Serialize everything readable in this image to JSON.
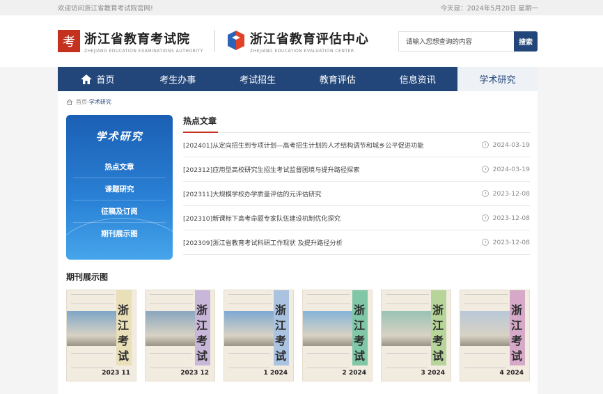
{
  "topbar": {
    "welcome": "欢迎访问浙江省教育考试院官网!",
    "date": "今天是：2024年5月20日 星期一"
  },
  "header": {
    "logo1_name": "浙江省教育考试院",
    "logo1_en": "ZHEJIANG EDUCATION EXAMINATIONS AUTHORITY",
    "logo1_mark": "考",
    "logo2_name": "浙江省教育评估中心",
    "logo2_en": "ZHEJIANG EDUCATION EVALUATION CENTER"
  },
  "search": {
    "placeholder": "请输入您想查询的内容",
    "button": "搜索"
  },
  "nav": [
    "首页",
    "考生办事",
    "考试招生",
    "教育评估",
    "信息资讯",
    "学术研究"
  ],
  "breadcrumb": {
    "home": "首页",
    "sep": "-",
    "current": "学术研究"
  },
  "sidebar": {
    "title": "学术研究",
    "links": [
      "热点文章",
      "课题研究",
      "征稿及订阅",
      "期刊展示图"
    ]
  },
  "hot": {
    "title": "热点文章",
    "items": [
      {
        "text": "[202401]从定向招生到专项计划—高考招生计划的人才结构调节和城乡公平促进功能",
        "date": "2024-03-19"
      },
      {
        "text": "[202312]应用型高校研究生招生考试监督困境与提升路径探索",
        "date": "2024-03-19"
      },
      {
        "text": "[202311]大规模学校办学质量评估的元评估研究",
        "date": "2023-12-08"
      },
      {
        "text": "[202310]新课标下高考命题专家队伍建设机制优化探究",
        "date": "2023-12-08"
      },
      {
        "text": "[202309]浙江省教育考试科研工作现状 及提升路径分析",
        "date": "2023-12-08"
      }
    ]
  },
  "journal": {
    "title": "期刊展示图",
    "covers": [
      {
        "cn": "浙江考试",
        "num": "2023 11",
        "band": "#e9dfb8",
        "photo": "#7fa6c7"
      },
      {
        "cn": "浙江考试",
        "num": "2023 12",
        "band": "#c9b7d9",
        "photo": "#8aa6bf"
      },
      {
        "cn": "浙江考试",
        "num": "1 2024",
        "band": "#a9c3e0",
        "photo": "#7ea8d3"
      },
      {
        "cn": "浙江考试",
        "num": "2 2024",
        "band": "#7fc7a7",
        "photo": "#86b4d8"
      },
      {
        "cn": "浙江考试",
        "num": "3 2024",
        "band": "#b7d59a",
        "photo": "#99c2b5"
      },
      {
        "cn": "浙江考试",
        "num": "4 2024",
        "band": "#d5a9c7",
        "photo": "#b8c8d8"
      }
    ]
  }
}
